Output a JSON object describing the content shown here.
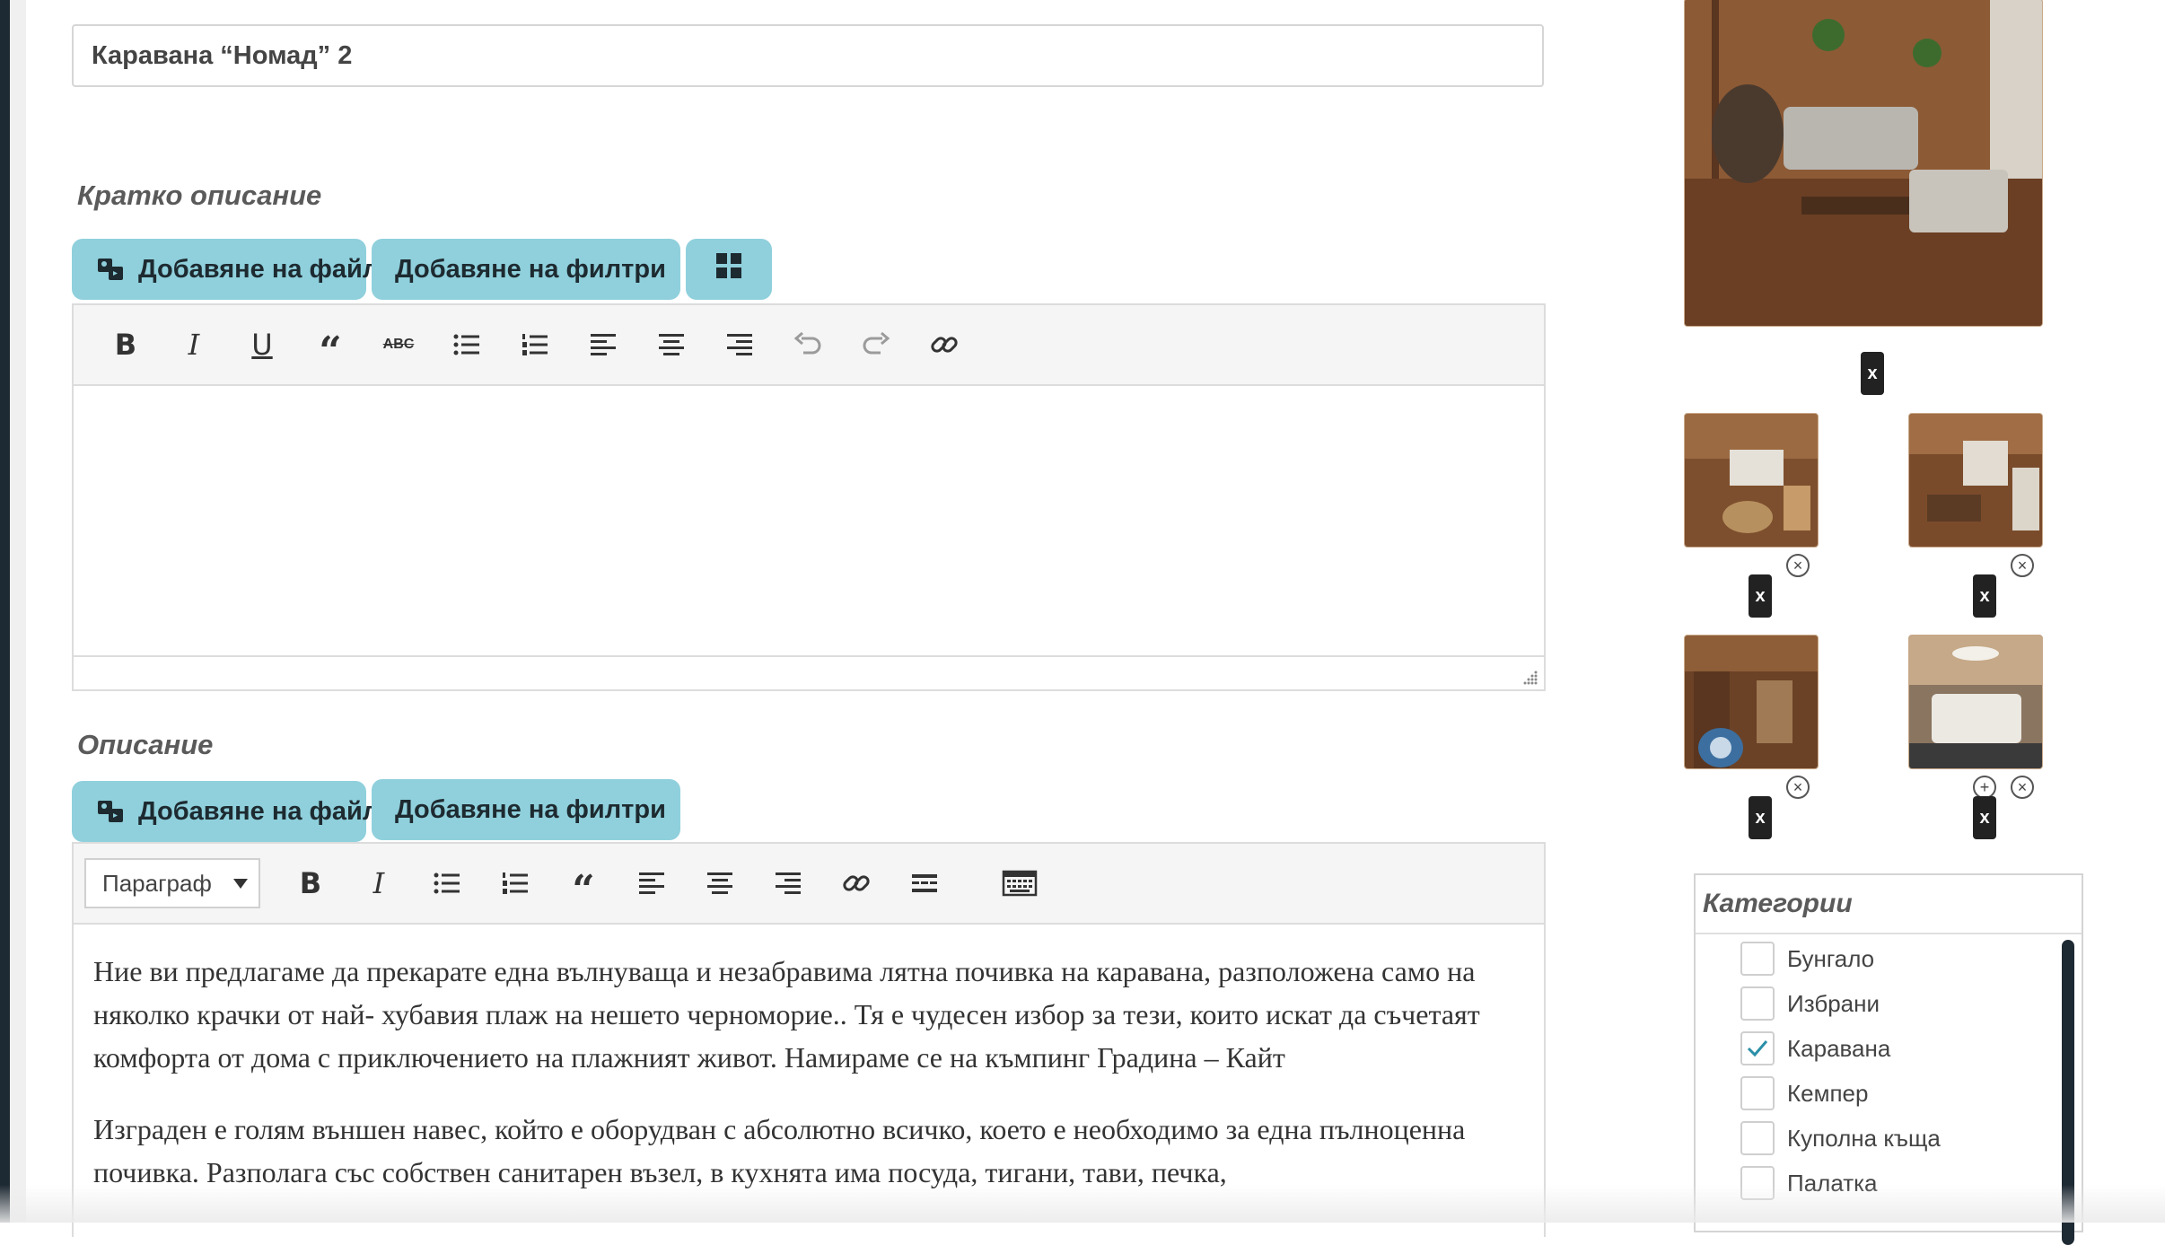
{
  "title_field": {
    "value": "Каравана “Номад” 2"
  },
  "short_desc": {
    "label": "Кратко описание",
    "add_file": "Добавяне на файл",
    "add_filters": "Добавяне на филтри"
  },
  "desc": {
    "label": "Описание",
    "add_file": "Добавяне на файл",
    "add_filters": "Добавяне на филтри",
    "format_select": "Параграф",
    "paragraphs": [
      "Ние ви предлагаме да прекарате една вълнуваща и незабравима лятна почивка на каравана, разположена само на няколко крачки от най- хубавия плаж на нешето черноморие.. Тя е чудесен избор за тези, които искат да съчетаят комфорта от дома с приключението на плажният живот. Намираме се на къмпинг Градина – Кайт",
      "Изграден е голям външен навес, който е оборудван с абсолютно всичко, което е необходимо за една пълноценна почивка. Разполага със собствен санитарен възел, в кухнята има посуда, тигани, тави, печка,"
    ]
  },
  "gallery": {
    "remove_label": "x"
  },
  "categories": {
    "title": "Категории",
    "items": [
      {
        "label": "Бунгало",
        "checked": false
      },
      {
        "label": "Избрани",
        "checked": false
      },
      {
        "label": "Каравана",
        "checked": true
      },
      {
        "label": "Кемпер",
        "checked": false
      },
      {
        "label": "Куполна къща",
        "checked": false
      },
      {
        "label": "Палатка",
        "checked": false
      }
    ]
  },
  "colors": {
    "accent_button": "#8fd0dc",
    "dark": "#1e2a33",
    "check": "#2a8fa8"
  }
}
